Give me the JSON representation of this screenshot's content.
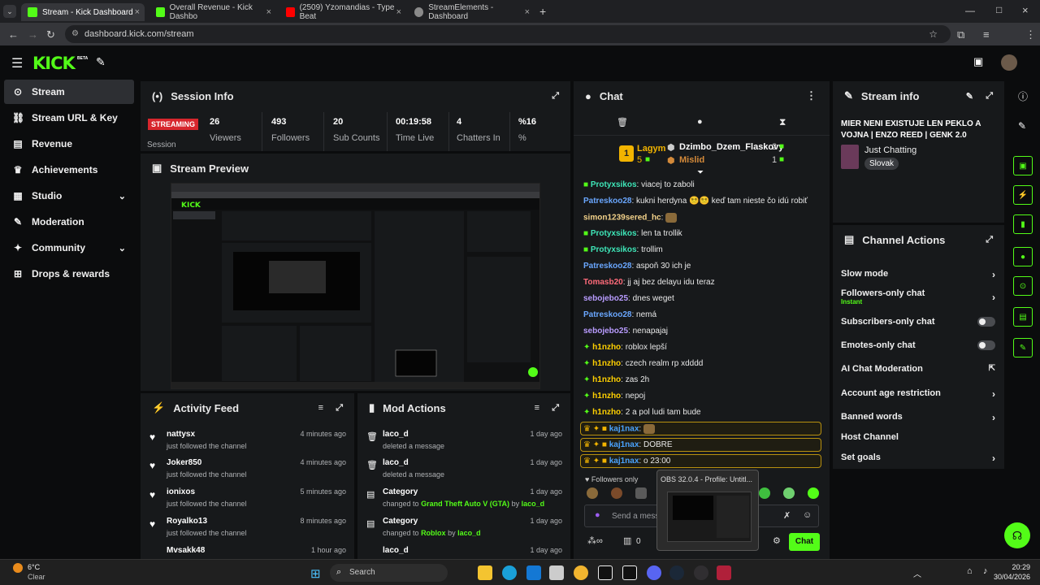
{
  "browser": {
    "tabs": [
      {
        "title": "Stream - Kick Dashboard",
        "color": "#53fc18"
      },
      {
        "title": "Overall Revenue - Kick Dashbo",
        "color": "#53fc18"
      },
      {
        "title": "(2509) Yzomandias - Type Beat",
        "color": "#ff0000"
      },
      {
        "title": "StreamElements - Dashboard",
        "color": "#8a8a8a"
      }
    ],
    "url": "dashboard.kick.com/stream"
  },
  "brand": {
    "logo": "KICK",
    "beta": "BETA",
    "accent": "#53fc18"
  },
  "sidebar": {
    "items": [
      {
        "label": "Stream",
        "icon": "broadcast-icon"
      },
      {
        "label": "Stream URL & Key",
        "icon": "link-icon"
      },
      {
        "label": "Revenue",
        "icon": "chart-icon"
      },
      {
        "label": "Achievements",
        "icon": "trophy-icon"
      },
      {
        "label": "Studio",
        "icon": "studio-icon"
      },
      {
        "label": "Moderation",
        "icon": "wrench-icon"
      },
      {
        "label": "Community",
        "icon": "users-icon"
      },
      {
        "label": "Drops & rewards",
        "icon": "gift-icon"
      }
    ]
  },
  "session": {
    "title": "Session Info",
    "badge": "STREAMING",
    "badge_sub": "Session",
    "stats": [
      {
        "value": "26",
        "label": "Viewers"
      },
      {
        "value": "493",
        "label": "Followers"
      },
      {
        "value": "20",
        "label": "Sub Counts"
      },
      {
        "value": "00:19:58",
        "label": "Time Live"
      },
      {
        "value": "4",
        "label": "Chatters In"
      },
      {
        "value": "%16",
        "label": "%"
      }
    ]
  },
  "preview": {
    "title": "Stream Preview"
  },
  "activity": {
    "title": "Activity Feed",
    "items": [
      {
        "name": "nattysx",
        "sub": "just followed the channel",
        "time": "4 minutes ago"
      },
      {
        "name": "Joker850",
        "sub": "just followed the channel",
        "time": "4 minutes ago"
      },
      {
        "name": "ionixos",
        "sub": "just followed the channel",
        "time": "5 minutes ago"
      },
      {
        "name": "Royalko13",
        "sub": "just followed the channel",
        "time": "8 minutes ago"
      },
      {
        "name": "Mvsakk48",
        "sub": "",
        "time": "1 hour ago"
      }
    ]
  },
  "mod": {
    "title": "Mod Actions",
    "items": [
      {
        "name": "laco_d",
        "sub": "deleted a message",
        "time": "1 day ago"
      },
      {
        "name": "laco_d",
        "sub": "deleted a message",
        "time": "1 day ago"
      },
      {
        "name": "Category",
        "pre": "changed to",
        "game": "Grand Theft Auto V (GTA)",
        "by": "by",
        "who": "laco_d",
        "time": "1 day ago"
      },
      {
        "name": "Category",
        "pre": "changed to",
        "game": "Roblox",
        "by": "by",
        "who": "laco_d",
        "time": "1 day ago"
      },
      {
        "name": "laco_d",
        "sub": "",
        "time": "1 day ago"
      }
    ]
  },
  "chat": {
    "title": "Chat",
    "leader": {
      "rank": "1",
      "name": "Lagym",
      "count": "5"
    },
    "top2": {
      "name": "Dzimbo_Dzem_Flaskovy",
      "count": "2"
    },
    "top3": {
      "name": "Mislid",
      "count": "1"
    },
    "messages": [
      {
        "user": "Protyxsikos",
        "text": "viacej to zaboli",
        "color": "#3ee6b8"
      },
      {
        "user": "Patreskoo28",
        "text": "kukni herdyna 😵‍💫😵‍💫 keď tam nieste čo idú robiť",
        "color": "#6aa7ff"
      },
      {
        "user": "simon1239sered_hc",
        "text": "",
        "color": "#f3d28a"
      },
      {
        "user": "Protyxsikos",
        "text": "len ta trollik",
        "color": "#3ee6b8"
      },
      {
        "user": "Protyxsikos",
        "text": "trollim",
        "color": "#3ee6b8"
      },
      {
        "user": "Patreskoo28",
        "text": "aspoň 30 ich je",
        "color": "#6aa7ff"
      },
      {
        "user": "Tomasb20",
        "text": "jj aj bez delayu idu teraz",
        "color": "#ff6b7a"
      },
      {
        "user": "sebojebo25",
        "text": "dnes weget",
        "color": "#b99cff"
      },
      {
        "user": "Patreskoo28",
        "text": "nemá",
        "color": "#6aa7ff"
      },
      {
        "user": "sebojebo25",
        "text": "nenapajaj",
        "color": "#b99cff"
      },
      {
        "user": "h1nzho",
        "text": "roblox lepší",
        "color": "#ffd000"
      },
      {
        "user": "h1nzho",
        "text": "czech realm rp xdddd",
        "color": "#ffd000"
      },
      {
        "user": "h1nzho",
        "text": "zas 2h",
        "color": "#ffd000"
      },
      {
        "user": "h1nzho",
        "text": "nepoj",
        "color": "#ffd000"
      },
      {
        "user": "h1nzho",
        "text": "2 a pol ludi tam bude",
        "color": "#ffd000"
      },
      {
        "user": "kaj1nax",
        "text": "",
        "color": "#4aa3ff"
      },
      {
        "user": "kaj1nax",
        "text": "DOBRE",
        "color": "#4aa3ff"
      },
      {
        "user": "kaj1nax",
        "text": "o 23:00",
        "color": "#4aa3ff"
      }
    ],
    "mode": "Followers only",
    "placeholder": "Send a mess",
    "viewer_count": "0",
    "send": "Chat"
  },
  "stream_info": {
    "title": "Stream info",
    "stream_title": "MIER NENI EXISTUJE LEN PEKLO A VOJNA | ENZO REED | GENK 2.0",
    "category": "Just Chatting",
    "tag": "Slovak"
  },
  "channel_actions": {
    "title": "Channel Actions",
    "rows": [
      {
        "label": "Slow mode",
        "kind": "arrow"
      },
      {
        "label": "Followers-only chat",
        "sub": "Instant",
        "kind": "arrow"
      },
      {
        "label": "Subscribers-only chat",
        "kind": "toggle"
      },
      {
        "label": "Emotes-only chat",
        "kind": "toggle"
      },
      {
        "label": "AI Chat Moderation",
        "kind": "external"
      },
      {
        "label": "Account age restriction",
        "kind": "arrow"
      },
      {
        "label": "Banned words",
        "kind": "arrow"
      },
      {
        "label": "Host Channel",
        "kind": "none"
      },
      {
        "label": "Set goals",
        "kind": "arrow"
      }
    ]
  },
  "obs_tooltip": "OBS 32.0.4 - Profile: Untitl...",
  "taskbar": {
    "weather_temp": "6°C",
    "weather_desc": "Clear",
    "search": "Search",
    "time": "20:29",
    "date": "30/04/2026"
  }
}
